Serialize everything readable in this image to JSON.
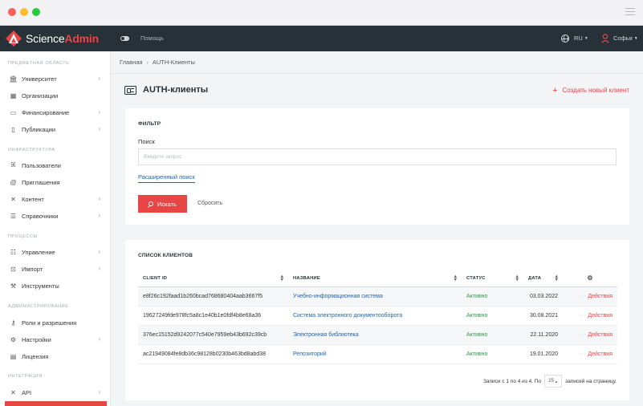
{
  "app": {
    "brand_a": "Science",
    "brand_b": "Admin"
  },
  "topbar": {
    "help": "Помощь",
    "lang": "RU",
    "user": "Софья"
  },
  "sidebar": {
    "sections": [
      {
        "title": "ПРЕДМЕТНАЯ ОБЛАСТЬ"
      },
      {
        "title": "ИНФРАСТРУКТУРА"
      },
      {
        "title": "ПРОЦЕССЫ"
      },
      {
        "title": "АДМИНИСТРИРОВАНИЕ"
      },
      {
        "title": "ИНТЕГРАЦИЯ"
      }
    ],
    "items": [
      {
        "label": "Университет",
        "icon": "university-icon"
      },
      {
        "label": "Организации",
        "icon": "building-icon"
      },
      {
        "label": "Финансирование",
        "icon": "money-icon"
      },
      {
        "label": "Публикации",
        "icon": "book-icon"
      },
      {
        "label": "Пользователи",
        "icon": "users-icon"
      },
      {
        "label": "Приглашения",
        "icon": "at-icon"
      },
      {
        "label": "Контент",
        "icon": "content-icon"
      },
      {
        "label": "Справочники",
        "icon": "list-icon"
      },
      {
        "label": "Управление",
        "icon": "sliders-icon"
      },
      {
        "label": "Импорт",
        "icon": "import-icon"
      },
      {
        "label": "Инструменты",
        "icon": "wrench-icon"
      },
      {
        "label": "Роли и разрешения",
        "icon": "key-icon"
      },
      {
        "label": "Настройки",
        "icon": "gear-icon"
      },
      {
        "label": "Лицензия",
        "icon": "document-icon"
      },
      {
        "label": "API",
        "icon": "api-icon"
      }
    ]
  },
  "breadcrumb": {
    "home": "Главная",
    "current": "AUTH-Клиенты"
  },
  "page": {
    "title": "AUTH-клиенты",
    "create": "Создать новый клиент"
  },
  "filter": {
    "title": "ФИЛЬТР",
    "search_label": "Поиск",
    "search_placeholder": "Введите запрос",
    "advanced": "Расширенный поиск",
    "search_button": "Искать",
    "reset": "Сбросить"
  },
  "list": {
    "title": "СПИСОК КЛИЕНТОВ",
    "columns": {
      "client_id": "CLIENT ID",
      "name": "НАЗВАНИЕ",
      "status": "СТАТУС",
      "date": "ДАТА"
    },
    "rows": [
      {
        "client_id": "e8f26c192faad1b260bcad768680404aab3667f5",
        "name": "Учебно-информационная система",
        "status": "Активно",
        "date": "03.03.2022",
        "action": "Действия"
      },
      {
        "client_id": "19627249fde978fc5a8c1e40b1e0fdf4b8e68a36",
        "name": "Система электронного документооборота",
        "status": "Активно",
        "date": "30.08.2021",
        "action": "Действия"
      },
      {
        "client_id": "376ec15152d9242077c540e7959eb43b692c39cb",
        "name": "Электронная библиотека",
        "status": "Активно",
        "date": "22.11.2020",
        "action": "Действия"
      },
      {
        "client_id": "ac21949084fe8db36c98128b0230b463bd8abd38",
        "name": "Репозиторий",
        "status": "Активно",
        "date": "19.01.2020",
        "action": "Действия"
      }
    ],
    "pager": {
      "summary": "Записи с 1 по 4 из 4. По",
      "page_size": "25",
      "suffix": "записей на страницу."
    }
  },
  "colors": {
    "accent": "#e84545",
    "topbar": "#263238",
    "link": "#1e63b8",
    "active": "#2c9a4f"
  }
}
